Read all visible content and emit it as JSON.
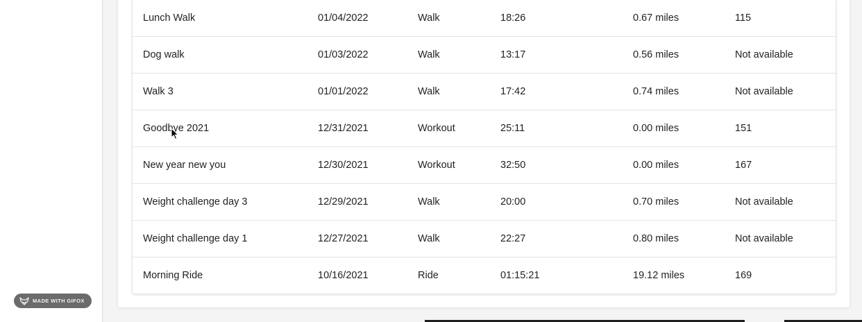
{
  "badge": {
    "label": "MADE WITH GIFOX",
    "icon": "fox-icon"
  },
  "activities": [
    {
      "name": "Lunch Walk",
      "date": "01/04/2022",
      "type": "Walk",
      "duration": "18:26",
      "distance": "0.67 miles",
      "heart_rate": "115"
    },
    {
      "name": "Dog walk",
      "date": "01/03/2022",
      "type": "Walk",
      "duration": "13:17",
      "distance": "0.56 miles",
      "heart_rate": "Not available"
    },
    {
      "name": "Walk 3",
      "date": "01/01/2022",
      "type": "Walk",
      "duration": "17:42",
      "distance": "0.74 miles",
      "heart_rate": "Not available"
    },
    {
      "name": "Goodbye 2021",
      "date": "12/31/2021",
      "type": "Workout",
      "duration": "25:11",
      "distance": "0.00 miles",
      "heart_rate": "151"
    },
    {
      "name": "New year new you",
      "date": "12/30/2021",
      "type": "Workout",
      "duration": "32:50",
      "distance": "0.00 miles",
      "heart_rate": "167"
    },
    {
      "name": "Weight challenge day 3",
      "date": "12/29/2021",
      "type": "Walk",
      "duration": "20:00",
      "distance": "0.70 miles",
      "heart_rate": "Not available"
    },
    {
      "name": "Weight challenge day 1",
      "date": "12/27/2021",
      "type": "Walk",
      "duration": "22:27",
      "distance": "0.80 miles",
      "heart_rate": "Not available"
    },
    {
      "name": "Morning Ride",
      "date": "10/16/2021",
      "type": "Ride",
      "duration": "01:15:21",
      "distance": "19.12 miles",
      "heart_rate": "169"
    }
  ],
  "colors": {
    "text": "#222222",
    "divider": "#e3e3e3",
    "badge_bg": "#6b6b6b"
  }
}
